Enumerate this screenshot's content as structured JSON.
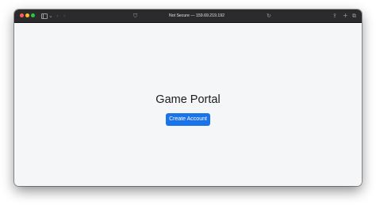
{
  "browser": {
    "address_text": "Not Secure — 159.69.219.192",
    "icons": {
      "sidebar": "sidebar-icon",
      "chevron": "chevron-down-icon",
      "back": "back-arrow-icon",
      "forward": "forward-arrow-icon",
      "shield": "shield-icon",
      "reload": "reload-icon",
      "share": "share-icon",
      "new_tab": "plus-icon",
      "tabs": "tab-overview-icon"
    },
    "traffic_colors": {
      "close": "#fe5f57",
      "minimize": "#febc2e",
      "maximize": "#28c840"
    }
  },
  "page": {
    "title": "Game Portal",
    "primary_button_label": "Create Account",
    "accent_color": "#1a73e8",
    "background_color": "#f5f6f8"
  }
}
